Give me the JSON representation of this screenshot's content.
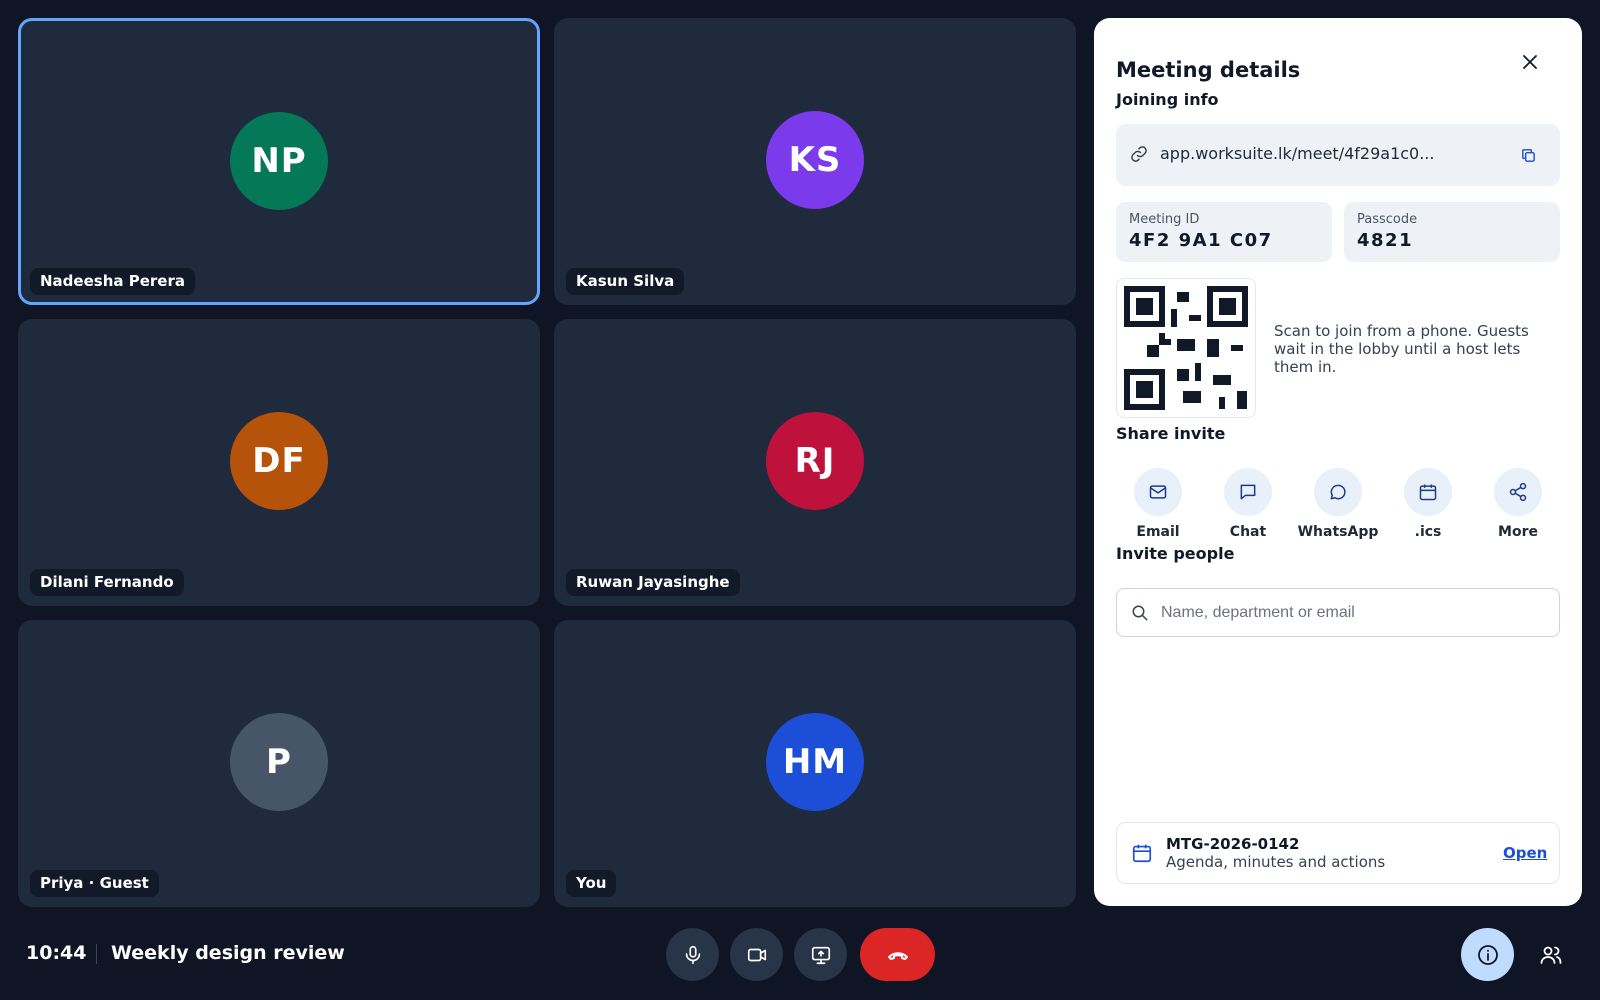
{
  "participants": [
    {
      "initials": "NP",
      "name": "Nadeesha Perera",
      "color": "#047857",
      "active": true
    },
    {
      "initials": "KS",
      "name": "Kasun Silva",
      "color": "#7c3aed",
      "active": false
    },
    {
      "initials": "DF",
      "name": "Dilani Fernando",
      "color": "#b45309",
      "active": false
    },
    {
      "initials": "RJ",
      "name": "Ruwan Jayasinghe",
      "color": "#be123c",
      "active": false
    },
    {
      "initials": "P",
      "name": "Priya · Guest",
      "color": "#475569",
      "active": false
    },
    {
      "initials": "HM",
      "name": "You",
      "color": "#1d4ed8",
      "active": false
    }
  ],
  "panel": {
    "title": "Meeting details",
    "joining_label": "Joining info",
    "link": "app.worksuite.lk/meet/4f29a1c0...",
    "meeting_id_label": "Meeting ID",
    "meeting_id": "4F2 9A1 C07",
    "passcode_label": "Passcode",
    "passcode": "4821",
    "qr_description": "Scan to join from a phone. Guests wait in the lobby until a host lets them in.",
    "share_label": "Share invite",
    "share_options": [
      {
        "label": "Email",
        "icon": "mail-icon"
      },
      {
        "label": "Chat",
        "icon": "chat-icon"
      },
      {
        "label": "WhatsApp",
        "icon": "whatsapp-icon"
      },
      {
        "label": ".ics",
        "icon": "calendar-icon"
      },
      {
        "label": "More",
        "icon": "share-icon"
      }
    ],
    "invite_label": "Invite people",
    "invite_placeholder": "Name, department or email",
    "record": {
      "id": "MTG-2026-0142",
      "subtitle": "Agenda, minutes and actions",
      "open_label": "Open"
    }
  },
  "footer": {
    "time": "10:44",
    "meeting_title": "Weekly design review"
  },
  "colors": {
    "background": "#0f1524",
    "tile": "#1f2a3c",
    "active_border": "#63a4ff",
    "end_call": "#dc2626",
    "accent_link": "#1d4ed8"
  }
}
